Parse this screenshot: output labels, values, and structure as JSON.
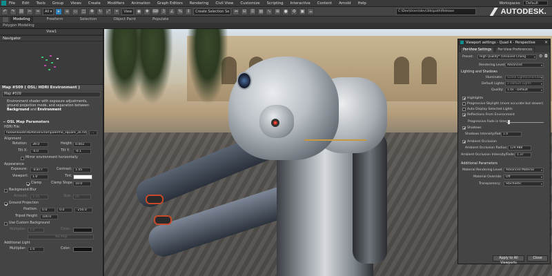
{
  "menubar": {
    "items": [
      "File",
      "Edit",
      "Tools",
      "Group",
      "Views",
      "Create",
      "Modifiers",
      "Animation",
      "Graph Editors",
      "Rendering",
      "Civil View",
      "Customize",
      "Scripting",
      "Interactive",
      "Content",
      "Arnold",
      "Help"
    ],
    "workspaces_label": "Workspaces:",
    "workspaces_value": "Default"
  },
  "toolbar": {
    "view_drop": "View",
    "selection_set": "Create Selection Se",
    "path": "C:\\Dev\\Users\\dev\\3ds\\path\\Release",
    "brand": "AUTODESK."
  },
  "ribbon": {
    "tabs": [
      "Modeling",
      "Freeform",
      "Selection",
      "Object Paint",
      "Populate"
    ],
    "sub": "Polygon Modeling"
  },
  "left": {
    "view_label": "View1",
    "navigator_title": "Navigator",
    "map_header": "Map #509  ( OSL: HDRI Environment )",
    "map_name": "Map #509",
    "desc_1": "Environment shader with exposure adjustments,",
    "desc_2": "ground projection mode, and separation between",
    "desc_bold_1": "Background",
    "desc_and": " and ",
    "desc_bold_2": "Environment",
    "params_title": "OSL Map Parameters",
    "hdri_file_label": "HDRI File:",
    "hdri_file_value": "l\\Downloads\\HDRIs\\environ\\palermo_square_2k.hdr",
    "alignment_label": "Alignment",
    "rotation_label": "Rotation:",
    "rotation_value": "39.0",
    "height_label": "Height:",
    "height_value": "0.002",
    "tiltx_label": "Tilt X:",
    "tiltx_value": "-0.0",
    "tilty_label": "Tilt Y:",
    "tilty_value": "-0.1",
    "mirror_label": "Mirror environment horizontally",
    "appearance_label": "Appearance",
    "exposure_label": "Exposure:",
    "exposure_value": "-0.877",
    "contrast_label": "Contrast:",
    "contrast_value": "1.05",
    "viewport_label": "Viewport:",
    "viewport_value": "1.0",
    "tint_label": "Tint:",
    "clamp_label": "Clamp",
    "clamp_stops_label": "Clamp Stops:",
    "clamp_stops_value": "10.0",
    "bg_blur_label": "Background Blur",
    "amount_label": "Amount:",
    "amount_value": "1.25",
    "size_label": "Size:",
    "size_value": "25",
    "ground_proj_label": "Ground Projection",
    "position_label": "Position:",
    "pos_x": "0.0",
    "pos_y": "0.0",
    "pos_z": "-250.0",
    "tripod_label": "Tripod Height:",
    "tripod_value": "100.0",
    "custom_bg_label": "Use Custom Background",
    "multiplier_label": "Multiplier:",
    "multiplier_value": "1.0",
    "color_label": "Color:",
    "no_map": "No Map",
    "additional_light": "Additional Light",
    "mult2_label": "Multiplier:",
    "mult2_value": "1.0",
    "color2_label": "Color:"
  },
  "dialog": {
    "title": "Viewport settings - Quad 4 - Perspective",
    "tabs": [
      "Per-View Settings",
      "Per-View Preferences"
    ],
    "preset_label": "Preset:",
    "preset_value": "High Quality* (Unsaved Chang",
    "rendering_level_label": "Rendering Level:",
    "rendering_level_value": "Advanced",
    "lighting_section": "Lighting and Shadows",
    "illuminate_label": "Illuminate:",
    "illuminate_value": "Scene Lights(Unlimited)",
    "default_lights_label": "Default Lights:",
    "default_lights_value": "2 Default Lights",
    "quality_label": "Quality:",
    "quality_value": "1.0x - Default",
    "highlights": "Highlights",
    "progressive": "Progressive Skylight (more accurate but slower)",
    "auto_display": "Auto Display Selected Lights",
    "reflections": "Reflections From Environment",
    "progressive_fade": "Progressive Fade in time:",
    "shadows": "Shadows",
    "shadow_intensity_label": "Shadows Intensity/Fade:",
    "shadow_intensity_value": "1.0",
    "ambient_occlusion": "Ambient Occlusion",
    "ao_radius_label": "Ambient Occlusion Radius:",
    "ao_radius_value": "129.988",
    "ao_intensity_label": "Ambient Occlusion Intensity/Fade:",
    "ao_intensity_value": "1.37",
    "additional_params": "Additional Parameters",
    "material_rendering_label": "Material Rendering Level:",
    "material_rendering_value": "Advanced Material",
    "material_override_label": "Material Override:",
    "material_override_value": "Off",
    "transparency_label": "Transparency:",
    "transparency_value": "Stochastic",
    "apply_button": "Apply to All Viewports",
    "close_button": "Close"
  },
  "colors": {
    "accent": "#2c7fb8",
    "app_icon": "#0e8f8f",
    "tint": "#ffffff"
  }
}
